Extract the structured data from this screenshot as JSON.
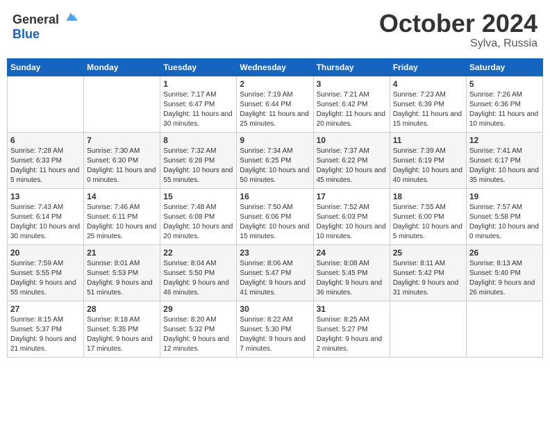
{
  "header": {
    "logo_general": "General",
    "logo_blue": "Blue",
    "month": "October 2024",
    "location": "Sylva, Russia"
  },
  "weekdays": [
    "Sunday",
    "Monday",
    "Tuesday",
    "Wednesday",
    "Thursday",
    "Friday",
    "Saturday"
  ],
  "weeks": [
    [
      {
        "day": "",
        "sunrise": "",
        "sunset": "",
        "daylight": ""
      },
      {
        "day": "",
        "sunrise": "",
        "sunset": "",
        "daylight": ""
      },
      {
        "day": "1",
        "sunrise": "Sunrise: 7:17 AM",
        "sunset": "Sunset: 6:47 PM",
        "daylight": "Daylight: 11 hours and 30 minutes."
      },
      {
        "day": "2",
        "sunrise": "Sunrise: 7:19 AM",
        "sunset": "Sunset: 6:44 PM",
        "daylight": "Daylight: 11 hours and 25 minutes."
      },
      {
        "day": "3",
        "sunrise": "Sunrise: 7:21 AM",
        "sunset": "Sunset: 6:42 PM",
        "daylight": "Daylight: 11 hours and 20 minutes."
      },
      {
        "day": "4",
        "sunrise": "Sunrise: 7:23 AM",
        "sunset": "Sunset: 6:39 PM",
        "daylight": "Daylight: 11 hours and 15 minutes."
      },
      {
        "day": "5",
        "sunrise": "Sunrise: 7:26 AM",
        "sunset": "Sunset: 6:36 PM",
        "daylight": "Daylight: 11 hours and 10 minutes."
      }
    ],
    [
      {
        "day": "6",
        "sunrise": "Sunrise: 7:28 AM",
        "sunset": "Sunset: 6:33 PM",
        "daylight": "Daylight: 11 hours and 5 minutes."
      },
      {
        "day": "7",
        "sunrise": "Sunrise: 7:30 AM",
        "sunset": "Sunset: 6:30 PM",
        "daylight": "Daylight: 11 hours and 0 minutes."
      },
      {
        "day": "8",
        "sunrise": "Sunrise: 7:32 AM",
        "sunset": "Sunset: 6:28 PM",
        "daylight": "Daylight: 10 hours and 55 minutes."
      },
      {
        "day": "9",
        "sunrise": "Sunrise: 7:34 AM",
        "sunset": "Sunset: 6:25 PM",
        "daylight": "Daylight: 10 hours and 50 minutes."
      },
      {
        "day": "10",
        "sunrise": "Sunrise: 7:37 AM",
        "sunset": "Sunset: 6:22 PM",
        "daylight": "Daylight: 10 hours and 45 minutes."
      },
      {
        "day": "11",
        "sunrise": "Sunrise: 7:39 AM",
        "sunset": "Sunset: 6:19 PM",
        "daylight": "Daylight: 10 hours and 40 minutes."
      },
      {
        "day": "12",
        "sunrise": "Sunrise: 7:41 AM",
        "sunset": "Sunset: 6:17 PM",
        "daylight": "Daylight: 10 hours and 35 minutes."
      }
    ],
    [
      {
        "day": "13",
        "sunrise": "Sunrise: 7:43 AM",
        "sunset": "Sunset: 6:14 PM",
        "daylight": "Daylight: 10 hours and 30 minutes."
      },
      {
        "day": "14",
        "sunrise": "Sunrise: 7:46 AM",
        "sunset": "Sunset: 6:11 PM",
        "daylight": "Daylight: 10 hours and 25 minutes."
      },
      {
        "day": "15",
        "sunrise": "Sunrise: 7:48 AM",
        "sunset": "Sunset: 6:08 PM",
        "daylight": "Daylight: 10 hours and 20 minutes."
      },
      {
        "day": "16",
        "sunrise": "Sunrise: 7:50 AM",
        "sunset": "Sunset: 6:06 PM",
        "daylight": "Daylight: 10 hours and 15 minutes."
      },
      {
        "day": "17",
        "sunrise": "Sunrise: 7:52 AM",
        "sunset": "Sunset: 6:03 PM",
        "daylight": "Daylight: 10 hours and 10 minutes."
      },
      {
        "day": "18",
        "sunrise": "Sunrise: 7:55 AM",
        "sunset": "Sunset: 6:00 PM",
        "daylight": "Daylight: 10 hours and 5 minutes."
      },
      {
        "day": "19",
        "sunrise": "Sunrise: 7:57 AM",
        "sunset": "Sunset: 5:58 PM",
        "daylight": "Daylight: 10 hours and 0 minutes."
      }
    ],
    [
      {
        "day": "20",
        "sunrise": "Sunrise: 7:59 AM",
        "sunset": "Sunset: 5:55 PM",
        "daylight": "Daylight: 9 hours and 55 minutes."
      },
      {
        "day": "21",
        "sunrise": "Sunrise: 8:01 AM",
        "sunset": "Sunset: 5:53 PM",
        "daylight": "Daylight: 9 hours and 51 minutes."
      },
      {
        "day": "22",
        "sunrise": "Sunrise: 8:04 AM",
        "sunset": "Sunset: 5:50 PM",
        "daylight": "Daylight: 9 hours and 46 minutes."
      },
      {
        "day": "23",
        "sunrise": "Sunrise: 8:06 AM",
        "sunset": "Sunset: 5:47 PM",
        "daylight": "Daylight: 9 hours and 41 minutes."
      },
      {
        "day": "24",
        "sunrise": "Sunrise: 8:08 AM",
        "sunset": "Sunset: 5:45 PM",
        "daylight": "Daylight: 9 hours and 36 minutes."
      },
      {
        "day": "25",
        "sunrise": "Sunrise: 8:11 AM",
        "sunset": "Sunset: 5:42 PM",
        "daylight": "Daylight: 9 hours and 31 minutes."
      },
      {
        "day": "26",
        "sunrise": "Sunrise: 8:13 AM",
        "sunset": "Sunset: 5:40 PM",
        "daylight": "Daylight: 9 hours and 26 minutes."
      }
    ],
    [
      {
        "day": "27",
        "sunrise": "Sunrise: 8:15 AM",
        "sunset": "Sunset: 5:37 PM",
        "daylight": "Daylight: 9 hours and 21 minutes."
      },
      {
        "day": "28",
        "sunrise": "Sunrise: 8:18 AM",
        "sunset": "Sunset: 5:35 PM",
        "daylight": "Daylight: 9 hours and 17 minutes."
      },
      {
        "day": "29",
        "sunrise": "Sunrise: 8:20 AM",
        "sunset": "Sunset: 5:32 PM",
        "daylight": "Daylight: 9 hours and 12 minutes."
      },
      {
        "day": "30",
        "sunrise": "Sunrise: 8:22 AM",
        "sunset": "Sunset: 5:30 PM",
        "daylight": "Daylight: 9 hours and 7 minutes."
      },
      {
        "day": "31",
        "sunrise": "Sunrise: 8:25 AM",
        "sunset": "Sunset: 5:27 PM",
        "daylight": "Daylight: 9 hours and 2 minutes."
      },
      {
        "day": "",
        "sunrise": "",
        "sunset": "",
        "daylight": ""
      },
      {
        "day": "",
        "sunrise": "",
        "sunset": "",
        "daylight": ""
      }
    ]
  ]
}
